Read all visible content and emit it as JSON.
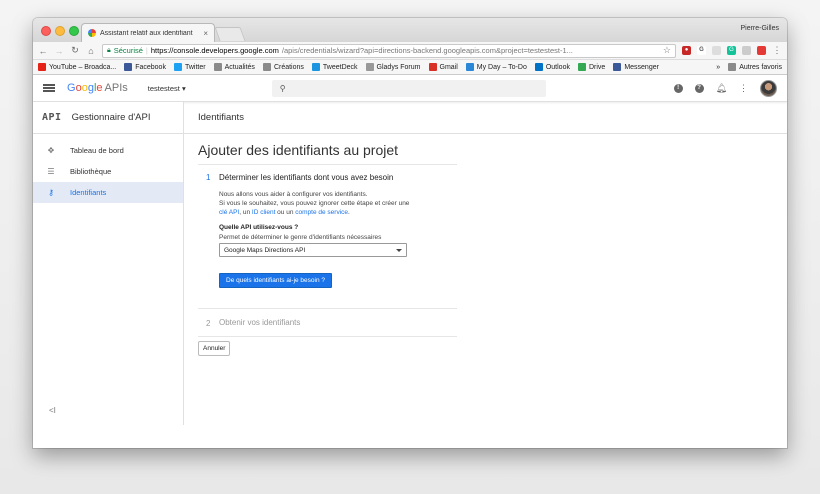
{
  "browser": {
    "tab_title": "Assistant relatif aux identifiant",
    "tab_close": "×",
    "profile_name": "Pierre-Gilles",
    "secure_label": "Sécurisé",
    "url_host": "https://console.developers.google.com",
    "url_path": "/apis/credentials/wizard?api=directions-backend.googleapis.com&project=testestest-1...",
    "bookmarks": [
      {
        "label": "YouTube – Broadca...",
        "color": "#e62117"
      },
      {
        "label": "Facebook",
        "color": "#3b5998"
      },
      {
        "label": "Twitter",
        "color": "#1da1f2"
      },
      {
        "label": "Actualités",
        "color": "#8a8a8a"
      },
      {
        "label": "Créations",
        "color": "#8a8a8a"
      },
      {
        "label": "TweetDeck",
        "color": "#1b95e0"
      },
      {
        "label": "Gladys Forum",
        "color": "#999999"
      },
      {
        "label": "Gmail",
        "color": "#d93025"
      },
      {
        "label": "My Day – To-Do",
        "color": "#2b88d8"
      },
      {
        "label": "Outlook",
        "color": "#0072c6"
      },
      {
        "label": "Drive",
        "color": "#34a853"
      },
      {
        "label": "Messenger",
        "color": "#3b5998"
      }
    ],
    "bookmarks_more": "»",
    "other_bookmarks": "Autres favoris"
  },
  "appbar": {
    "brand_google": [
      "G",
      "o",
      "o",
      "g",
      "l",
      "e"
    ],
    "brand_apis": "APIs",
    "project_name": "testestest",
    "project_caret": "▾",
    "search_icon": "⚲"
  },
  "sidebar": {
    "api_mark": "API",
    "title": "Gestionnaire d'API",
    "items": [
      {
        "label": "Tableau de bord",
        "icon": "dashboard-icon",
        "glyph": "✥"
      },
      {
        "label": "Bibliothèque",
        "icon": "library-icon",
        "glyph": "☰"
      },
      {
        "label": "Identifiants",
        "icon": "key-icon",
        "glyph": "⚷"
      }
    ],
    "collapse_glyph": "<I"
  },
  "main": {
    "header": "Identifiants",
    "page_title": "Ajouter des identifiants au projet",
    "step1": {
      "number": "1",
      "title": "Déterminer les identifiants dont vous avez besoin",
      "desc_line1": "Nous allons vous aider à configurer vos identifiants.",
      "desc_line2": "Si vous le souhaitez, vous pouvez ignorer cette étape et créer une",
      "link_api_key": "clé API",
      "sep1": ", un ",
      "link_client_id": "ID client",
      "sep2": " ou un ",
      "link_service_account": "compte de service",
      "end": ".",
      "question": "Quelle API utilisez-vous ?",
      "hint": "Permet de déterminer le genre d'identifiants nécessaires",
      "selected_api": "Google Maps Directions API",
      "button": "De quels identifiants ai-je besoin ?"
    },
    "step2": {
      "number": "2",
      "title": "Obtenir vos identifiants"
    },
    "cancel": "Annuler"
  },
  "colors": {
    "accent": "#1a73e8",
    "active_nav_bg": "#e3eaf6"
  }
}
